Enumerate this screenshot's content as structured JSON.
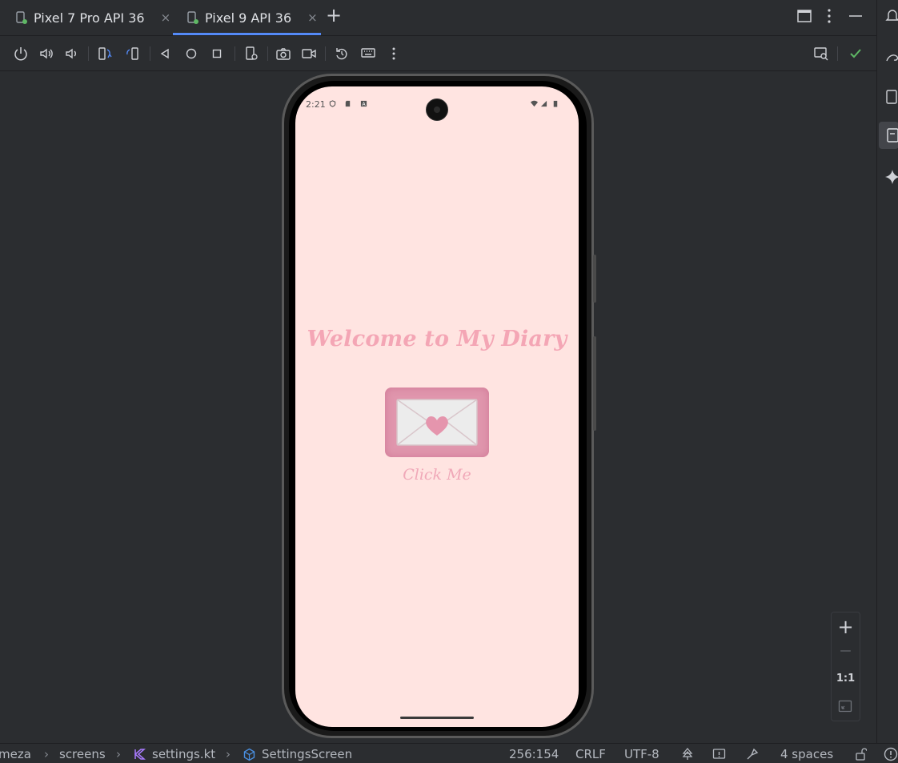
{
  "tabs": [
    {
      "label": "Pixel 7 Pro API 36"
    },
    {
      "label": "Pixel 9 API 36"
    }
  ],
  "tab_close_glyph": "×",
  "tab_add_glyph": "+",
  "toolbar_icons": [
    "power-icon",
    "volume-up-icon",
    "volume-down-icon",
    "rotate-left-icon",
    "rotate-right-icon",
    "back-icon",
    "home-icon",
    "overview-icon",
    "device-settings-icon",
    "camera-icon",
    "video-icon",
    "reset-icon",
    "keyboard-icon",
    "more-icon",
    "inspect-icon",
    "check-icon"
  ],
  "device": {
    "status_time": "2:21",
    "welcome": "Welcome to My Diary",
    "button_label": "Click Me"
  },
  "zoom": {
    "in": "+",
    "out": "—",
    "actual": "1:1"
  },
  "statusbar": {
    "crumb_1": "meza",
    "crumb_2": "screens",
    "crumb_3": "settings.kt",
    "crumb_4": "SettingsScreen",
    "position": "256:154",
    "line_ending": "CRLF",
    "encoding": "UTF-8",
    "indent": "4 spaces"
  },
  "colors": {
    "screen_bg": "#ffe4e1",
    "accent_pink": "#f4a6b5",
    "button_pink": "#e096ad",
    "ide_bg": "#2b2d30",
    "tab_underline": "#548af7",
    "check_green": "#5fb865"
  }
}
